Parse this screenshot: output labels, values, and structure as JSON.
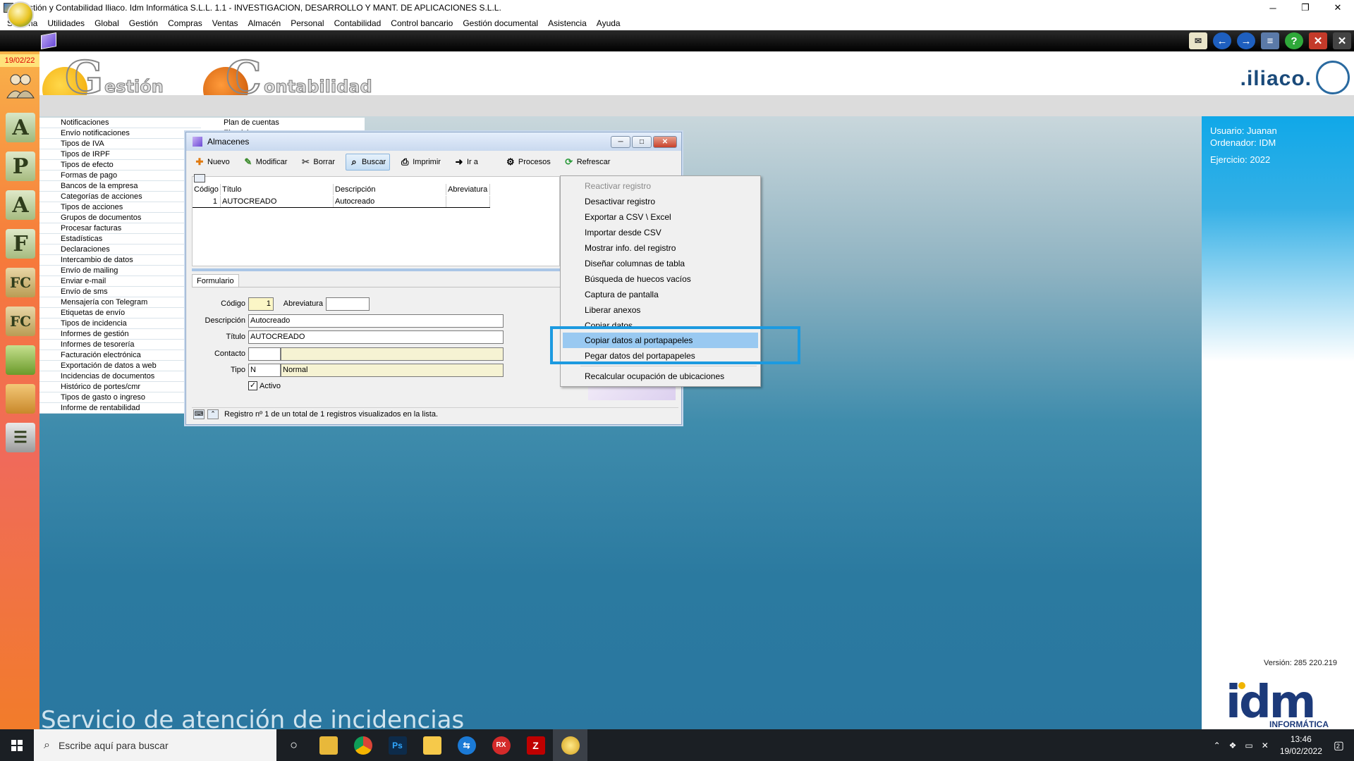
{
  "window": {
    "title": "Gestión y Contabilidad Iliaco. Idm Informática S.L.L. 1.1 - INVESTIGACION, DESARROLLO Y MANT. DE APLICACIONES S.L.L.",
    "minimize": "─",
    "restore": "❐",
    "close": "✕"
  },
  "menubar": [
    "Sistema",
    "Utilidades",
    "Global",
    "Gestión",
    "Compras",
    "Ventas",
    "Almacén",
    "Personal",
    "Contabilidad",
    "Control bancario",
    "Gestión documental",
    "Asistencia",
    "Ayuda"
  ],
  "date_badge": "19/02/22",
  "header": {
    "gestion_letter": "G",
    "gestion_word": "estión",
    "contabilidad_letter": "C",
    "contabilidad_word": "ontabilidad",
    "brand": ".iliaco."
  },
  "left_icons": [
    "users-icon",
    "a-stack-icon",
    "p-icon",
    "a-icon",
    "f-icon",
    "fc-icon",
    "fc2-icon",
    "box-icon",
    "package-icon",
    "book-icon"
  ],
  "menu_col1": [
    "Notificaciones",
    "Envío notificaciones",
    "Tipos de IVA",
    "Tipos de IRPF",
    "Tipos de efecto",
    "Formas de pago",
    "Bancos de la empresa",
    "Categorías de acciones",
    "Tipos de acciones",
    "Grupos de documentos",
    "Procesar facturas",
    "Estadísticas",
    "Declaraciones",
    "Intercambio de datos",
    "Envío de mailing",
    "Enviar e-mail",
    "Envío de sms",
    "Mensajería con Telegram",
    "Etiquetas de envío",
    "Tipos de incidencia",
    "Informes de gestión",
    "Informes de tesorería",
    "Facturación electrónica",
    "Exportación de datos a web",
    "Incidencias de documentos",
    "Histórico de portes/cmr",
    "Tipos de gasto o ingreso",
    "Informe de rentabilidad"
  ],
  "menu_col2": [
    "Plan de cuentas",
    "Ejercicios"
  ],
  "dialog": {
    "title": "Almacenes",
    "toolbar": [
      "Nuevo",
      "Modificar",
      "Borrar",
      "Buscar",
      "Imprimir",
      "Ir a",
      "Procesos",
      "Refrescar"
    ],
    "grid": {
      "columns": [
        "Código",
        "Título",
        "Descripción",
        "Abreviatura"
      ],
      "rows": [
        [
          "1",
          "AUTOCREADO",
          "Autocreado",
          ""
        ]
      ]
    },
    "tab": "Formulario",
    "form": {
      "codigo_label": "Código",
      "codigo_value": "1",
      "abreviatura_label": "Abreviatura",
      "abreviatura_value": "",
      "descripcion_label": "Descripción",
      "descripcion_value": "Autocreado",
      "titulo_label": "Título",
      "titulo_value": "AUTOCREADO",
      "contacto_label": "Contacto",
      "contacto_value": "",
      "tipo_label": "Tipo",
      "tipo_code": "N",
      "tipo_name": "Normal",
      "activo_label": "Activo",
      "activo_checked": true
    },
    "status": "Registro nº 1 de un total de 1 registros visualizados en la lista."
  },
  "context_menu": {
    "items": [
      {
        "label": "Reactivar registro",
        "disabled": true
      },
      {
        "label": "Desactivar registro",
        "disabled": false
      },
      {
        "label": "Exportar a CSV \\ Excel",
        "disabled": false
      },
      {
        "label": "Importar desde CSV",
        "disabled": false
      },
      {
        "label": "Mostrar info. del registro",
        "disabled": false
      },
      {
        "label": "Diseñar columnas de tabla",
        "disabled": false
      },
      {
        "label": "Búsqueda de huecos vacíos",
        "disabled": false
      },
      {
        "label": "Captura de pantalla",
        "disabled": false
      },
      {
        "label": "Liberar anexos",
        "disabled": false
      },
      {
        "label": "Copiar datos",
        "disabled": false
      },
      {
        "label": "Copiar datos al portapapeles",
        "disabled": false,
        "highlighted": true
      },
      {
        "label": "Pegar datos del portapapeles",
        "disabled": false
      },
      {
        "label": "Recalcular ocupación de ubicaciones",
        "disabled": false
      }
    ]
  },
  "right_panel": {
    "usuario": "Usuario: Juanan",
    "ordenador": "Ordenador: IDM",
    "ejercicio": "Ejercicio: 2022",
    "version": "Versión: 285 220.219",
    "idm": "idm",
    "idm_sub": "INFORMÁTICA"
  },
  "footer_text": "Servicio de atención de incidencias",
  "taskbar": {
    "search_placeholder": "Escribe aquí para buscar",
    "time": "13:46",
    "date": "19/02/2022",
    "notifications": "2"
  },
  "colors": {
    "highlight_box": "#1c9ae0",
    "context_hover": "#99c9f1",
    "right_panel": "#10a8e8"
  }
}
